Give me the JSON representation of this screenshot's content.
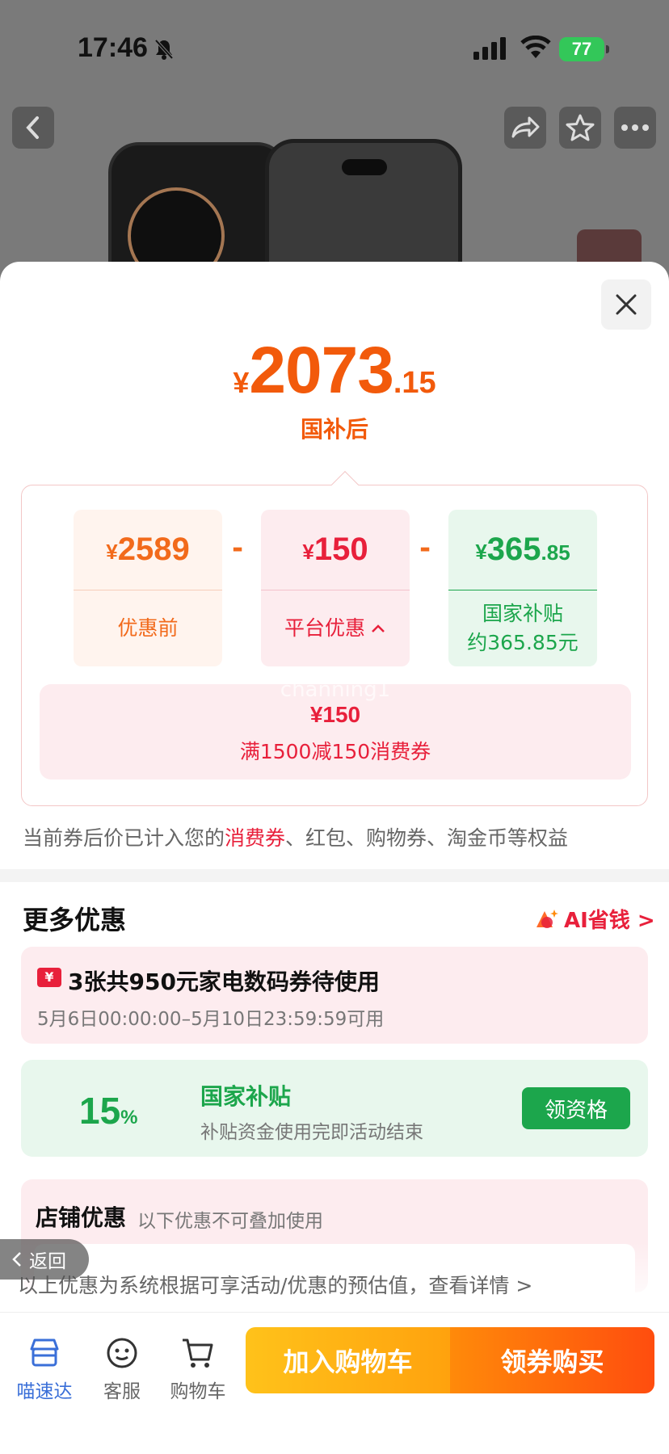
{
  "status_bar": {
    "time": "17:46",
    "battery": "77"
  },
  "nav": {
    "back_icon": "chevron-left-icon",
    "share_icon": "share-icon",
    "favorite_icon": "star-icon",
    "more_icon": "more-icon"
  },
  "price": {
    "symbol": "¥",
    "integer": "2073",
    "decimal": ".15",
    "label": "国补后"
  },
  "breakdown": {
    "original": {
      "symbol": "¥",
      "value": "2589",
      "label": "优惠前"
    },
    "platform": {
      "symbol": "¥",
      "value": "150",
      "label": "平台优惠",
      "caret": "^"
    },
    "subsidy": {
      "symbol": "¥",
      "value": "365",
      "decimal": ".85",
      "label_line1": "国家补贴",
      "label_line2": "约365.85元"
    },
    "minus": "-",
    "watermark": "channing1",
    "coupon_amount": "¥150",
    "coupon_desc": "满1500减150消费券"
  },
  "note": {
    "prefix": "当前券后价已计入您的",
    "highlight": "消费券",
    "suffix": "、红包、购物券、淘金币等权益"
  },
  "more": {
    "title": "更多优惠",
    "ai_link": "AI省钱 >",
    "coupons": {
      "badge": "¥",
      "title": "3张共950元家电数码券待使用",
      "sub": "5月6日00:00:00–5月10日23:59:59可用"
    },
    "subsidy": {
      "percent": "15",
      "percent_sign": "%",
      "title": "国家补贴",
      "sub": "补贴资金使用完即活动结束",
      "button": "领资格"
    },
    "store": {
      "title": "店铺优惠",
      "sub": "以下优惠不可叠加使用"
    }
  },
  "disclaimer": "以上优惠为系统根据可享活动/优惠的预估值，查看详情 >",
  "back_pill": "返回",
  "bottom": {
    "tabs": [
      {
        "label": "喵速达",
        "icon": "store-icon"
      },
      {
        "label": "客服",
        "icon": "chat-face-icon"
      },
      {
        "label": "购物车",
        "icon": "cart-icon"
      }
    ],
    "add_to_cart": "加入购物车",
    "buy": "领券购买"
  },
  "colors": {
    "accent_orange": "#f25a0b",
    "red": "#e8203b",
    "green": "#1ca64c"
  }
}
